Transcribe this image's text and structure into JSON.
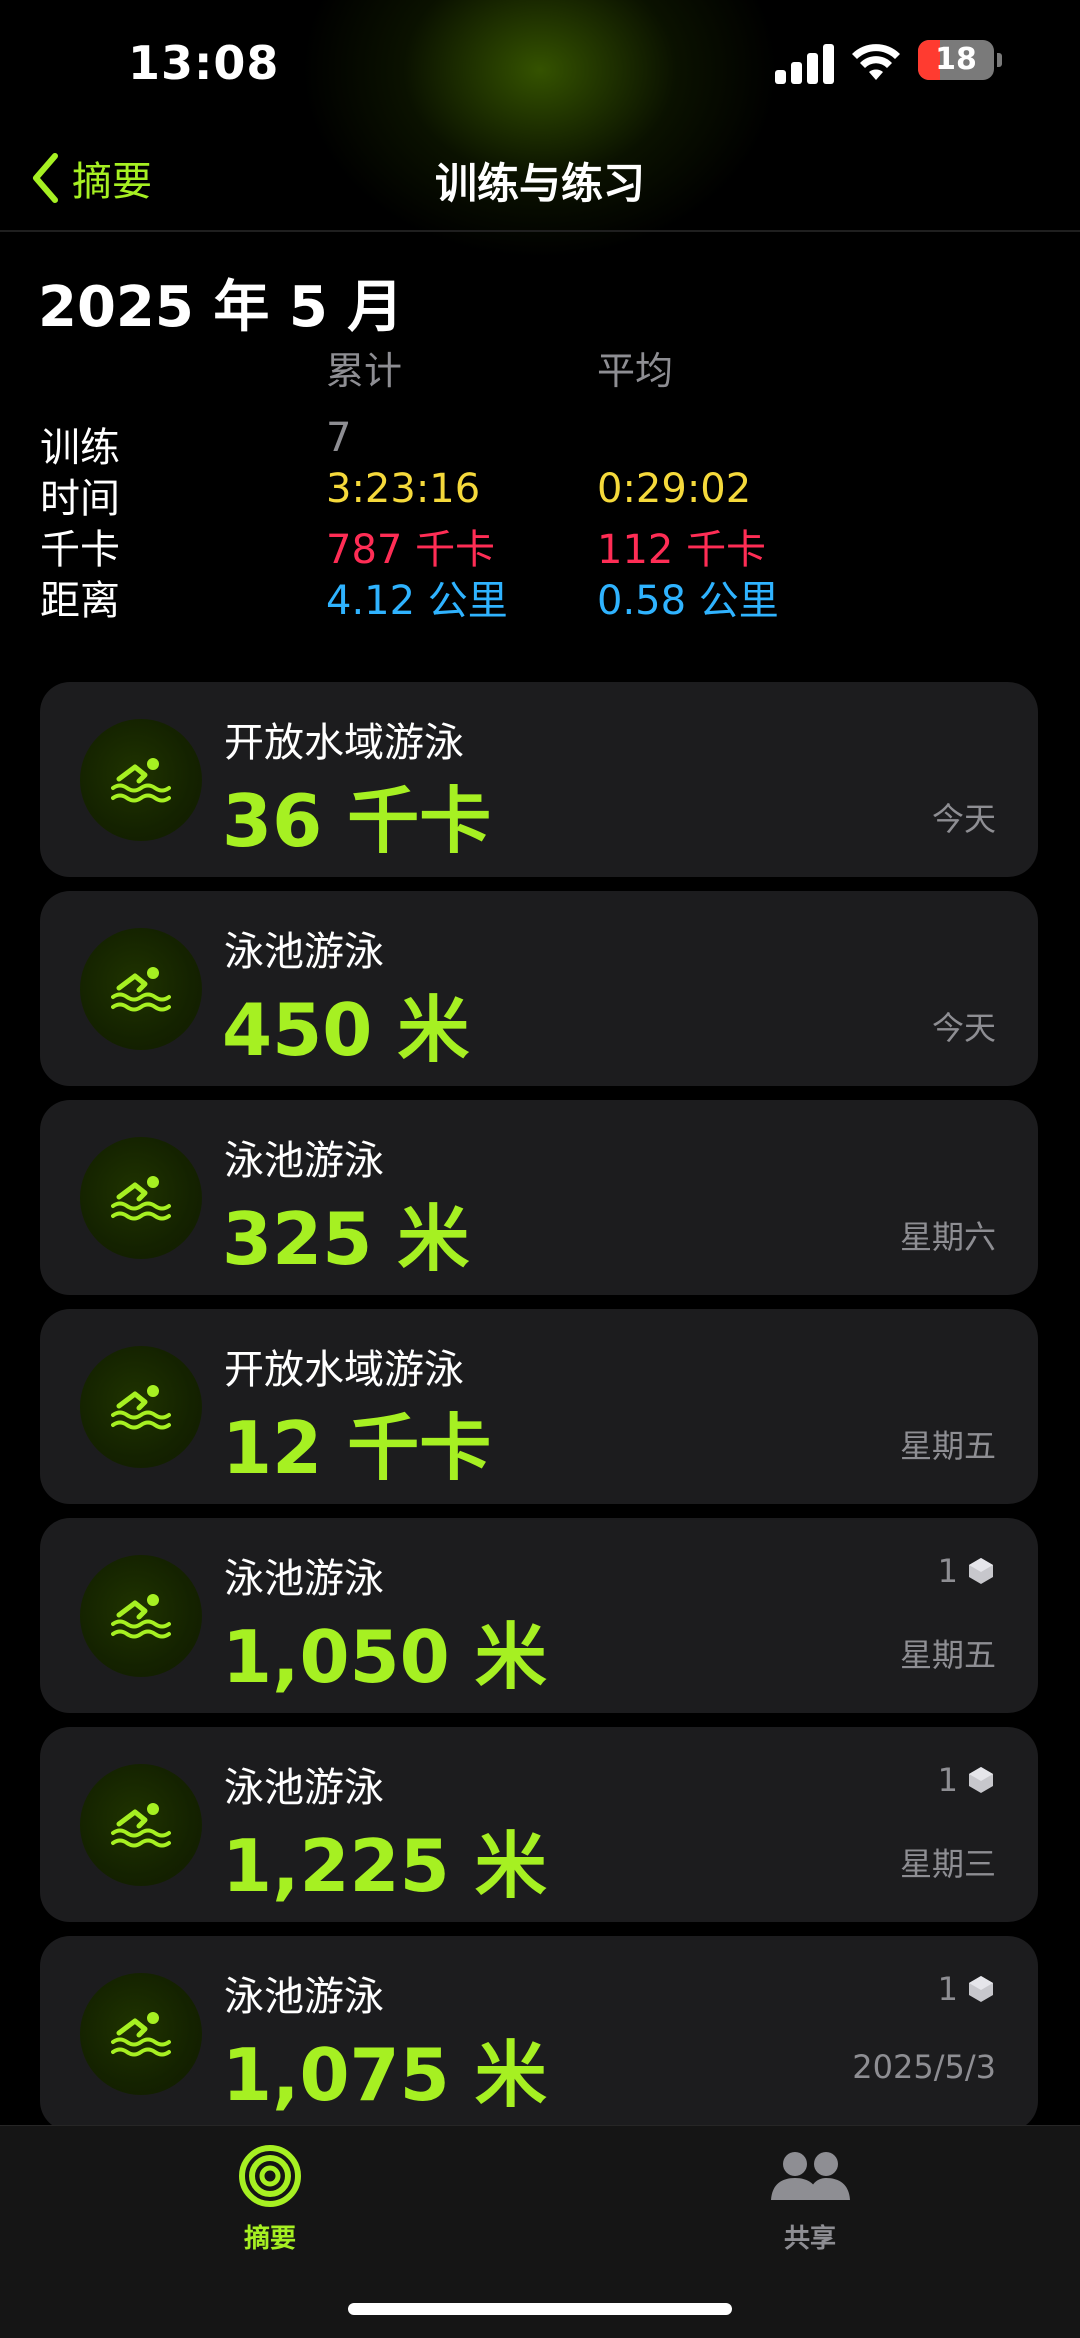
{
  "status_bar": {
    "time": "13:08",
    "battery": "18",
    "icons": [
      "cellular-signal-icon",
      "wifi-icon",
      "battery-icon"
    ]
  },
  "nav": {
    "back_label": "摘要",
    "title": "训练与练习",
    "back_icon": "chevron-left-icon"
  },
  "summary": {
    "month": "2025 年 5 月",
    "col_total": "累计",
    "col_avg": "平均",
    "rows": [
      {
        "label": "训练",
        "total": "7",
        "avg": ""
      },
      {
        "label": "时间",
        "total": "3:23:16",
        "avg": "0:29:02"
      },
      {
        "label": "千卡",
        "total": "787 千卡",
        "avg": "112 千卡"
      },
      {
        "label": "距离",
        "total": "4.12 公里",
        "avg": "0.58 公里"
      }
    ]
  },
  "workouts": [
    {
      "title": "开放水域游泳",
      "value": "36 千卡",
      "date": "今天",
      "badge": ""
    },
    {
      "title": "泳池游泳",
      "value": "450 米",
      "date": "今天",
      "badge": ""
    },
    {
      "title": "泳池游泳",
      "value": "325 米",
      "date": "星期六",
      "badge": ""
    },
    {
      "title": "开放水域游泳",
      "value": "12 千卡",
      "date": "星期五",
      "badge": ""
    },
    {
      "title": "泳池游泳",
      "value": "1,050 米",
      "date": "星期五",
      "badge": "1"
    },
    {
      "title": "泳池游泳",
      "value": "1,225 米",
      "date": "星期三",
      "badge": "1"
    },
    {
      "title": "泳池游泳",
      "value": "1,075 米",
      "date": "2025/5/3",
      "badge": "1"
    }
  ],
  "tabs": [
    {
      "label": "摘要",
      "icon": "activity-rings-icon",
      "active": true
    },
    {
      "label": "共享",
      "icon": "people-icon",
      "active": false
    }
  ],
  "colors": {
    "accent": "#a6f022",
    "yellow": "#f5d93b",
    "red": "#ff2d55",
    "blue": "#2fb3ff",
    "card": "#1c1c1e",
    "secondary": "#8e8e93"
  }
}
